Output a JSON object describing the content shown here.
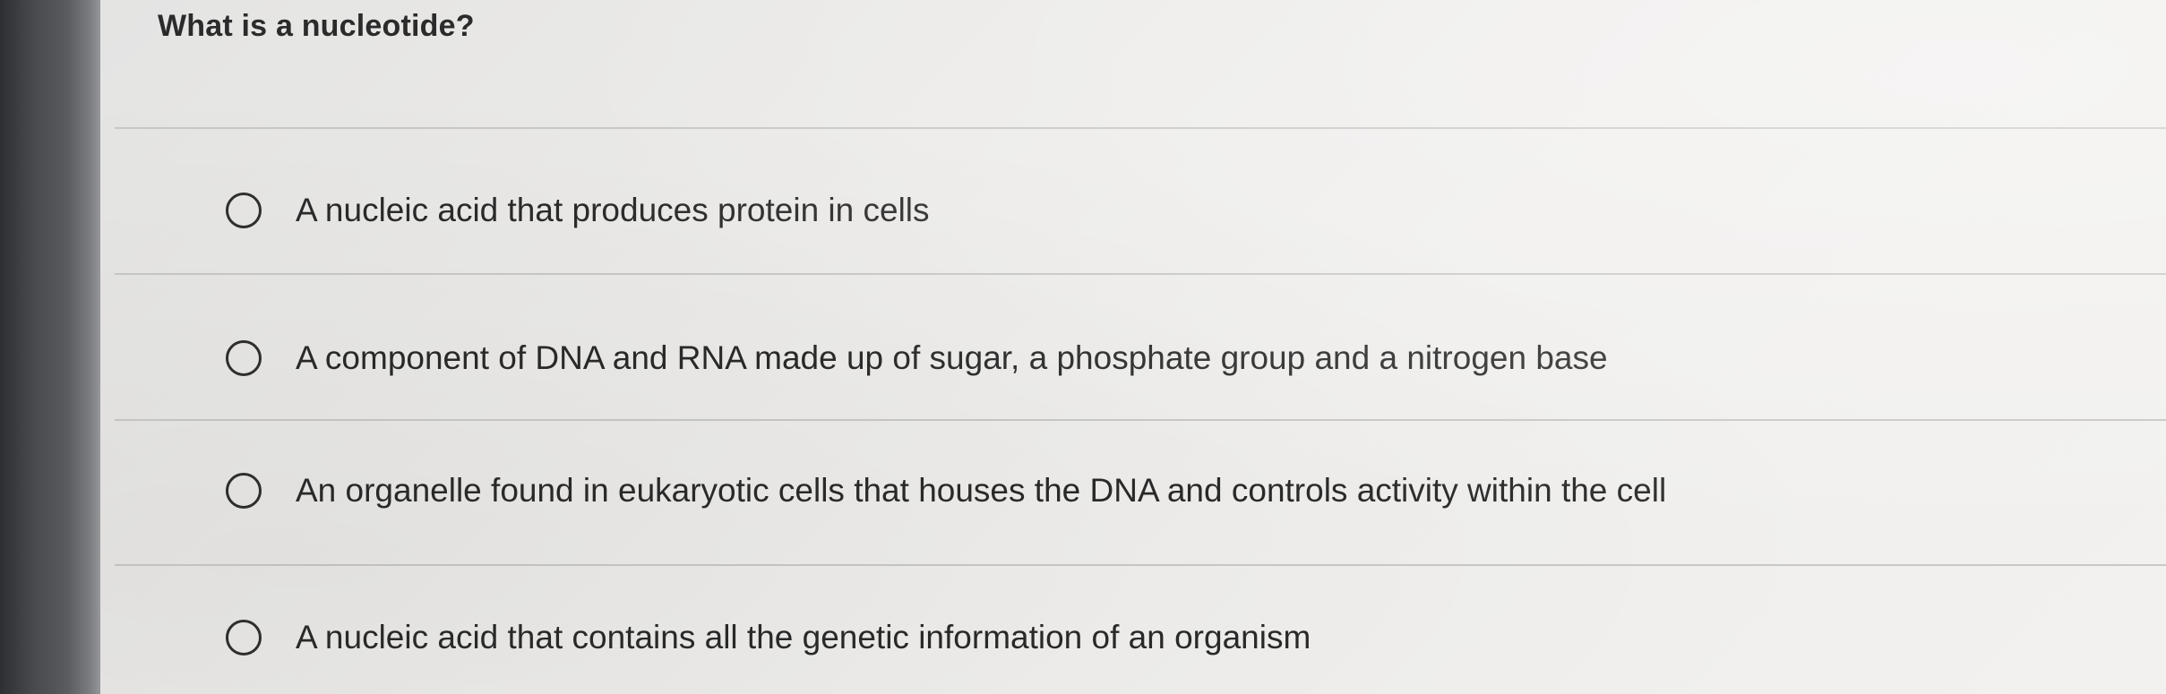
{
  "question": {
    "text": "What is a nucleotide?"
  },
  "options": [
    {
      "label": "A nucleic acid that produces protein in cells",
      "selected": false
    },
    {
      "label": "A component of DNA and RNA made up of sugar, a phosphate group and a nitrogen base",
      "selected": false
    },
    {
      "label": "An organelle found in eukaryotic cells that houses the DNA and controls activity within the cell",
      "selected": false
    },
    {
      "label": "A nucleic acid that contains all the genetic information of an organism",
      "selected": false
    }
  ]
}
